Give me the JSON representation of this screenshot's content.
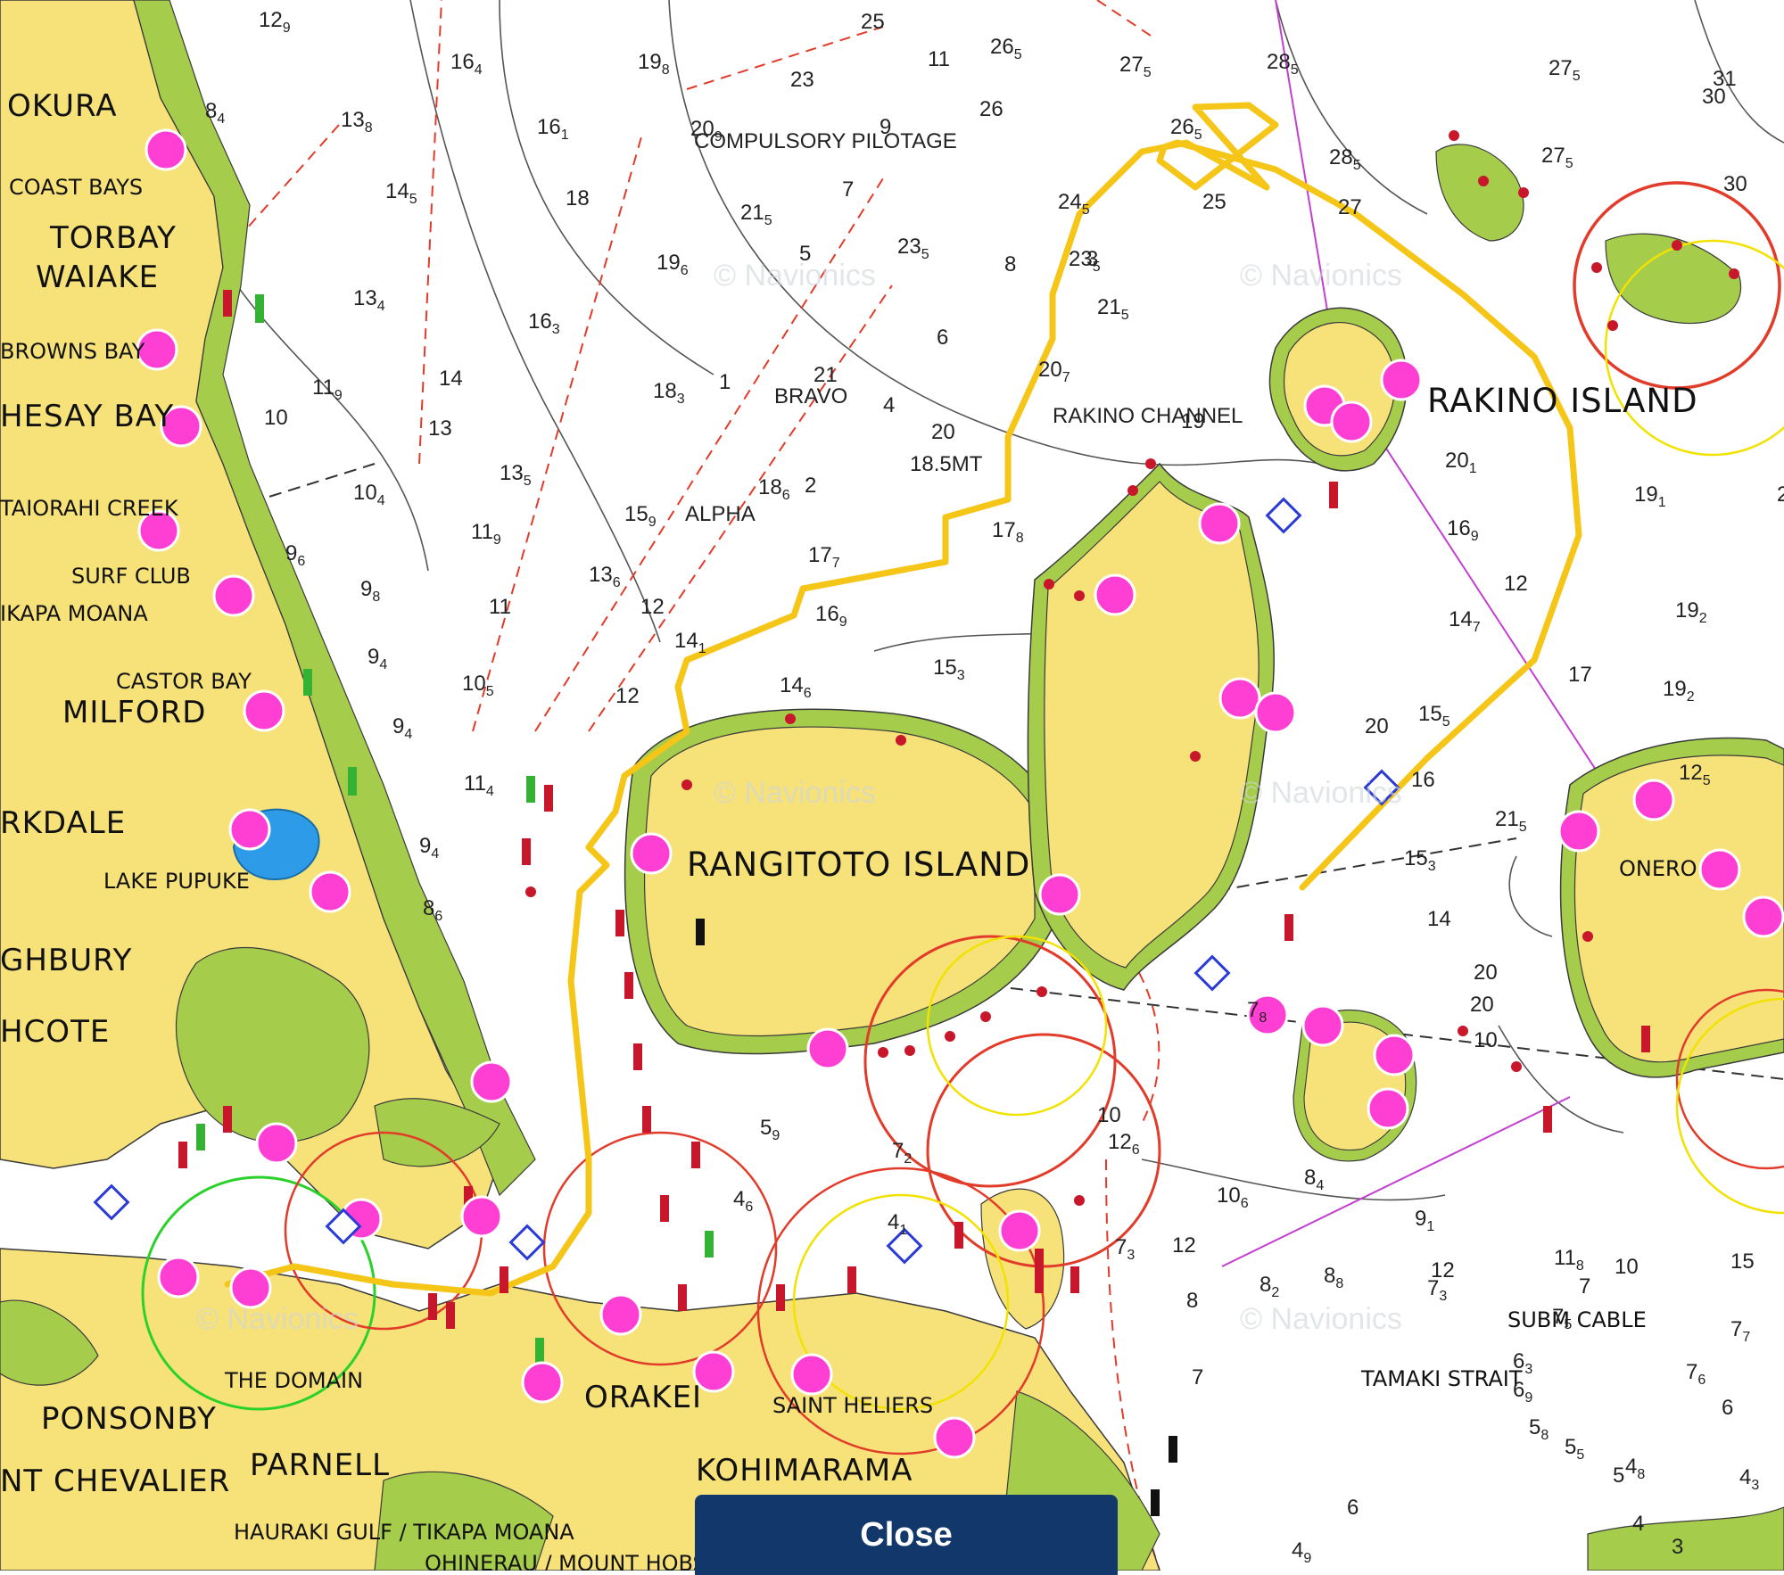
{
  "map": {
    "watermark": "© Navionics",
    "place_labels": {
      "okura": "OKURA",
      "coast_bays": "COAST BAYS",
      "torbay": "TORBAY",
      "waiake": "WAIAKE",
      "browns_bay": "BROWNS BAY",
      "mairangi_bay": "HESAY BAY",
      "taiorahi_creek": "TAIORAHI CREEK",
      "surf_club": "SURF CLUB",
      "tikapa_moana": "IKAPA MOANA",
      "castor_bay": "CASTOR BAY",
      "milford": "MILFORD",
      "takapuna": "RKDALE",
      "lake_pupuke": "LAKE PUPUKE",
      "highbury": "GHBURY",
      "northcote": "HCOTE",
      "the_domain": "THE DOMAIN",
      "ponsonby": "PONSONBY",
      "parnell": "PARNELL",
      "mount_chevalier": "NT CHEVALIER",
      "hauraki_gulf": "HAURAKI GULF / TIKAPA MOANA",
      "ohinerau": "OHINERAU / MOUNT HOBS",
      "orakei": "ORAKEI",
      "saint_heliers": "SAINT HELIERS",
      "kohimarama": "KOHIMARAMA",
      "rangitoto_island": "RANGITOTO ISLAND",
      "rakino_island": "RAKINO ISLAND",
      "motutapu": "ONERO",
      "tamaki_strait": "TAMAKI STRAIT",
      "subm_cable": "SUBM CABLE"
    },
    "chart_notes": {
      "compulsory_pilotage": "COMPULSORY PILOTAGE",
      "bravo": "BRAVO",
      "alpha": "ALPHA",
      "rakino_channel": "RAKINO CHANNEL",
      "depth_mark_18_5": "18.5MT"
    },
    "soundings": [
      {
        "t": "12",
        "s": "9"
      },
      {
        "t": "16",
        "s": "4"
      },
      {
        "t": "19",
        "s": "8"
      },
      {
        "t": "25",
        "s": ""
      },
      {
        "t": "11",
        "s": ""
      },
      {
        "t": "26",
        "s": "5"
      },
      {
        "t": "27",
        "s": "5"
      },
      {
        "t": "28",
        "s": "5"
      },
      {
        "t": "27",
        "s": "5"
      },
      {
        "t": "31",
        "s": ""
      },
      {
        "t": "8",
        "s": "4"
      },
      {
        "t": "13",
        "s": "8"
      },
      {
        "t": "16",
        "s": "1"
      },
      {
        "t": "23",
        "s": ""
      },
      {
        "t": "20",
        "s": "9"
      },
      {
        "t": "9",
        "s": ""
      },
      {
        "t": "26",
        "s": ""
      },
      {
        "t": "26",
        "s": "5"
      },
      {
        "t": "28",
        "s": "5"
      },
      {
        "t": "30",
        "s": ""
      },
      {
        "t": "14",
        "s": "5"
      },
      {
        "t": "18",
        "s": ""
      },
      {
        "t": "7",
        "s": ""
      },
      {
        "t": "21",
        "s": "5"
      },
      {
        "t": "24",
        "s": "5"
      },
      {
        "t": "25",
        "s": ""
      },
      {
        "t": "27",
        "s": ""
      },
      {
        "t": "27",
        "s": "5"
      },
      {
        "t": "30",
        "s": ""
      },
      {
        "t": "13",
        "s": "4"
      },
      {
        "t": "16",
        "s": "3"
      },
      {
        "t": "19",
        "s": "6"
      },
      {
        "t": "5",
        "s": ""
      },
      {
        "t": "23",
        "s": "5"
      },
      {
        "t": "8",
        "s": ""
      },
      {
        "t": "23",
        "s": "5"
      },
      {
        "t": "3",
        "s": ""
      },
      {
        "t": "21",
        "s": "5"
      },
      {
        "t": "11",
        "s": "9"
      },
      {
        "t": "14",
        "s": ""
      },
      {
        "t": "13",
        "s": ""
      },
      {
        "t": "10",
        "s": ""
      },
      {
        "t": "18",
        "s": "3"
      },
      {
        "t": "1",
        "s": ""
      },
      {
        "t": "21",
        "s": ""
      },
      {
        "t": "6",
        "s": ""
      },
      {
        "t": "4",
        "s": ""
      },
      {
        "t": "20",
        "s": ""
      },
      {
        "t": "20",
        "s": "7"
      },
      {
        "t": "10",
        "s": "4"
      },
      {
        "t": "13",
        "s": "5"
      },
      {
        "t": "15",
        "s": "9"
      },
      {
        "t": "18",
        "s": "6"
      },
      {
        "t": "2",
        "s": ""
      },
      {
        "t": "19",
        "s": ""
      },
      {
        "t": "20",
        "s": "1"
      },
      {
        "t": "19",
        "s": "1"
      },
      {
        "t": "25",
        "s": ""
      },
      {
        "t": "9",
        "s": "6"
      },
      {
        "t": "11",
        "s": "9"
      },
      {
        "t": "13",
        "s": "6"
      },
      {
        "t": "17",
        "s": "7"
      },
      {
        "t": "17",
        "s": "8"
      },
      {
        "t": "16",
        "s": "9"
      },
      {
        "t": "12",
        "s": ""
      },
      {
        "t": "19",
        "s": "2"
      },
      {
        "t": "9",
        "s": "8"
      },
      {
        "t": "11",
        "s": ""
      },
      {
        "t": "12",
        "s": ""
      },
      {
        "t": "14",
        "s": "1"
      },
      {
        "t": "16",
        "s": "9"
      },
      {
        "t": "14",
        "s": "7"
      },
      {
        "t": "17",
        "s": ""
      },
      {
        "t": "19",
        "s": "2"
      },
      {
        "t": "9",
        "s": "4"
      },
      {
        "t": "10",
        "s": "5"
      },
      {
        "t": "12",
        "s": ""
      },
      {
        "t": "14",
        "s": "6"
      },
      {
        "t": "15",
        "s": "3"
      },
      {
        "t": "20",
        "s": ""
      },
      {
        "t": "15",
        "s": "5"
      },
      {
        "t": "16",
        "s": ""
      },
      {
        "t": "9",
        "s": "4"
      },
      {
        "t": "11",
        "s": "4"
      },
      {
        "t": "9",
        "s": "4"
      },
      {
        "t": "8",
        "s": "6"
      },
      {
        "t": "21",
        "s": "5"
      },
      {
        "t": "15",
        "s": "3"
      },
      {
        "t": "14",
        "s": ""
      },
      {
        "t": "12",
        "s": "5"
      },
      {
        "t": "5",
        "s": "9"
      },
      {
        "t": "7",
        "s": "2"
      },
      {
        "t": "10",
        "s": ""
      },
      {
        "t": "12",
        "s": "6"
      },
      {
        "t": "10",
        "s": "6"
      },
      {
        "t": "7",
        "s": "8"
      },
      {
        "t": "20",
        "s": ""
      },
      {
        "t": "20",
        "s": ""
      },
      {
        "t": "10",
        "s": ""
      },
      {
        "t": "4",
        "s": "6"
      },
      {
        "t": "4",
        "s": "1"
      },
      {
        "t": "7",
        "s": "3"
      },
      {
        "t": "12",
        "s": ""
      },
      {
        "t": "9",
        "s": "1"
      },
      {
        "t": "12",
        "s": ""
      },
      {
        "t": "11",
        "s": "8"
      },
      {
        "t": "15",
        "s": ""
      },
      {
        "t": "8",
        "s": "2"
      },
      {
        "t": "8",
        "s": ""
      },
      {
        "t": "8",
        "s": "8"
      },
      {
        "t": "10",
        "s": ""
      },
      {
        "t": "8",
        "s": "4"
      },
      {
        "t": "7",
        "s": "3"
      },
      {
        "t": "7",
        "s": "5"
      },
      {
        "t": "7",
        "s": "7"
      },
      {
        "t": "7",
        "s": ""
      },
      {
        "t": "7",
        "s": "6"
      },
      {
        "t": "6",
        "s": "3"
      },
      {
        "t": "6",
        "s": "9"
      },
      {
        "t": "6",
        "s": ""
      },
      {
        "t": "7",
        "s": ""
      },
      {
        "t": "5",
        "s": "8"
      },
      {
        "t": "5",
        "s": "5"
      },
      {
        "t": "4",
        "s": "8"
      },
      {
        "t": "5",
        "s": ""
      },
      {
        "t": "4",
        "s": "3"
      },
      {
        "t": "6",
        "s": ""
      },
      {
        "t": "4",
        "s": ""
      },
      {
        "t": "4",
        "s": "9"
      },
      {
        "t": "3",
        "s": ""
      }
    ],
    "colors": {
      "land": "#f7e27a",
      "urban": "#9a9a9a",
      "intertidal": "#a6cc4c",
      "water": "#ffffff",
      "route": "#f5c518",
      "marina": "#ff3fd4",
      "boundary": "#e23b2a",
      "lake": "#2e9be8"
    }
  },
  "ui": {
    "close_label": "Close"
  }
}
